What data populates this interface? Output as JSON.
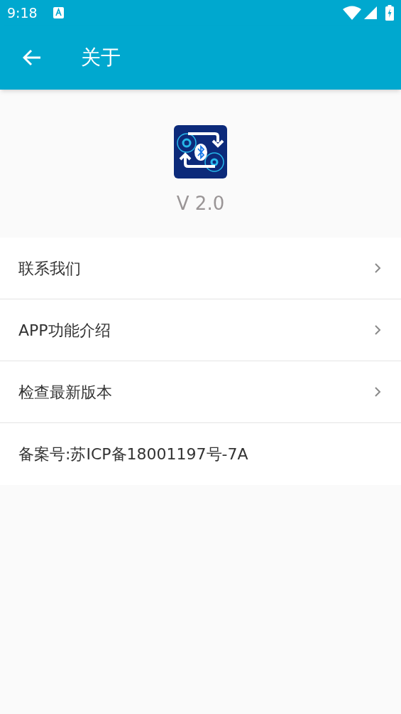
{
  "status_bar": {
    "time": "9:18"
  },
  "app_bar": {
    "title": "关于"
  },
  "app_info": {
    "version": "V 2.0"
  },
  "items": [
    {
      "label": "联系我们",
      "kind": "link"
    },
    {
      "label": "APP功能介绍",
      "kind": "link"
    },
    {
      "label": "检查最新版本",
      "kind": "link"
    },
    {
      "label": "备案号:苏ICP备18001197号-7A",
      "kind": "info"
    }
  ]
}
